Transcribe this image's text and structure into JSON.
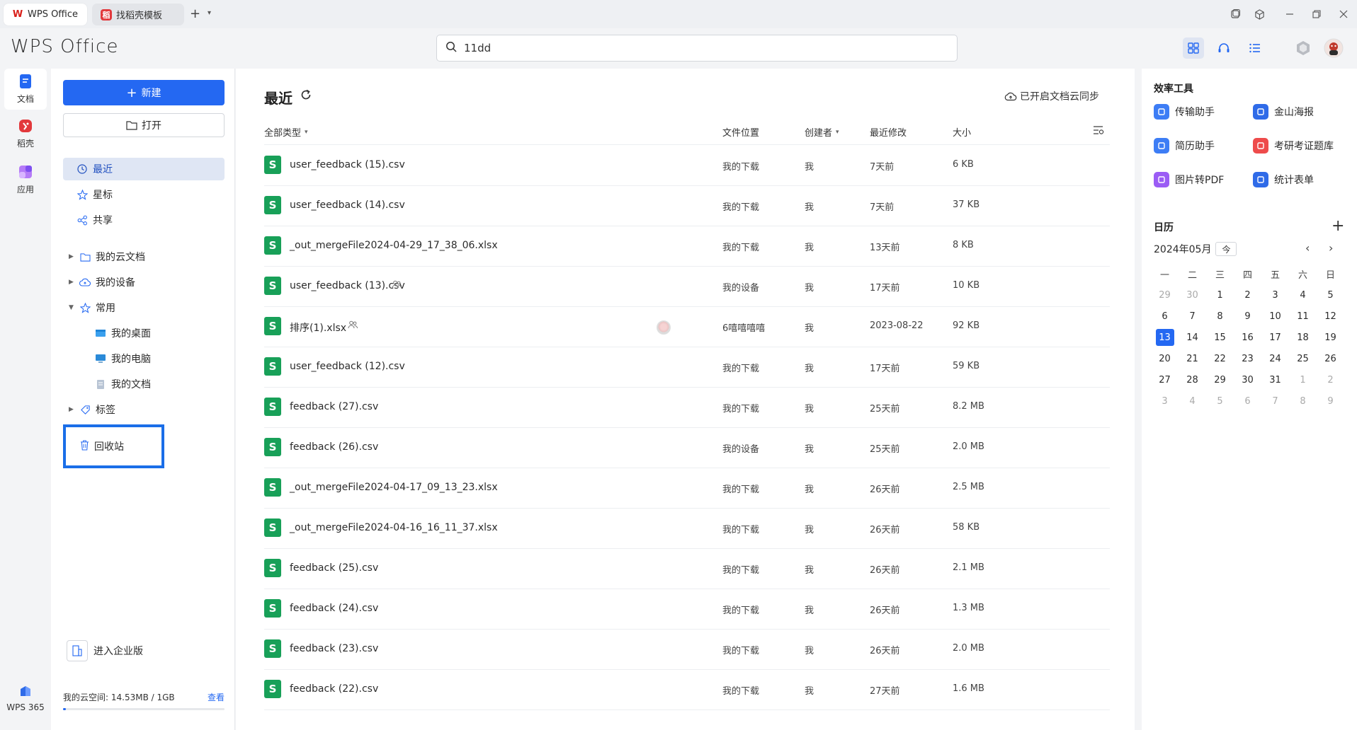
{
  "tabs": [
    {
      "label": "WPS Office"
    },
    {
      "label": "找稻壳模板"
    }
  ],
  "header": {
    "brand": "WPS Office",
    "search_value": "11dd"
  },
  "rail": {
    "items": [
      {
        "label": "文档"
      },
      {
        "label": "稻壳"
      },
      {
        "label": "应用"
      }
    ],
    "bottom_label": "WPS 365"
  },
  "sidebar": {
    "new_label": "新建",
    "open_label": "打开",
    "nav": [
      {
        "label": "最近"
      },
      {
        "label": "星标"
      },
      {
        "label": "共享"
      }
    ],
    "tree": [
      {
        "label": "我的云文档"
      },
      {
        "label": "我的设备"
      },
      {
        "label": "常用"
      },
      {
        "label": "我的桌面"
      },
      {
        "label": "我的电脑"
      },
      {
        "label": "我的文档"
      },
      {
        "label": "标签"
      }
    ],
    "recycle_label": "回收站",
    "enterprise_label": "进入企业版",
    "storage_label": "我的云空间: 14.53MB / 1GB",
    "storage_view": "查看",
    "storage_fraction": 0.014
  },
  "main": {
    "title": "最近",
    "sync_label": "已开启文档云同步",
    "columns": {
      "type": "全部类型",
      "location": "文件位置",
      "owner": "创建者",
      "modified": "最近修改",
      "size": "大小"
    },
    "files": [
      {
        "icon": "S",
        "name": "user_feedback (15).csv",
        "location": "我的下载",
        "owner": "我",
        "modified": "7天前",
        "size": "6 KB"
      },
      {
        "icon": "S",
        "name": "user_feedback (14).csv",
        "location": "我的下载",
        "owner": "我",
        "modified": "7天前",
        "size": "37 KB"
      },
      {
        "icon": "S",
        "name": "_out_mergeFile2024-04-29_17_38_06.xlsx",
        "location": "我的下载",
        "owner": "我",
        "modified": "13天前",
        "size": "8 KB"
      },
      {
        "icon": "S",
        "name": "user_feedback (13).csv",
        "location": "我的设备",
        "owner": "我",
        "modified": "17天前",
        "size": "10 KB"
      },
      {
        "icon": "S",
        "name": "排序(1).xlsx",
        "location": "6嘻嘻嘻嘻",
        "owner": "我",
        "modified": "2023-08-22",
        "size": "92 KB"
      },
      {
        "icon": "S",
        "name": "user_feedback (12).csv",
        "location": "我的下载",
        "owner": "我",
        "modified": "17天前",
        "size": "59 KB"
      },
      {
        "icon": "S",
        "name": "feedback (27).csv",
        "location": "我的下载",
        "owner": "我",
        "modified": "25天前",
        "size": "8.2 MB"
      },
      {
        "icon": "S",
        "name": "feedback (26).csv",
        "location": "我的设备",
        "owner": "我",
        "modified": "25天前",
        "size": "2.0 MB"
      },
      {
        "icon": "S",
        "name": "_out_mergeFile2024-04-17_09_13_23.xlsx",
        "location": "我的下载",
        "owner": "我",
        "modified": "26天前",
        "size": "2.5 MB"
      },
      {
        "icon": "S",
        "name": "_out_mergeFile2024-04-16_16_11_37.xlsx",
        "location": "我的下载",
        "owner": "我",
        "modified": "26天前",
        "size": "58 KB"
      },
      {
        "icon": "S",
        "name": "feedback (25).csv",
        "location": "我的下载",
        "owner": "我",
        "modified": "26天前",
        "size": "2.1 MB"
      },
      {
        "icon": "S",
        "name": "feedback (24).csv",
        "location": "我的下载",
        "owner": "我",
        "modified": "26天前",
        "size": "1.3 MB"
      },
      {
        "icon": "S",
        "name": "feedback (23).csv",
        "location": "我的下载",
        "owner": "我",
        "modified": "26天前",
        "size": "2.0 MB"
      },
      {
        "icon": "S",
        "name": "feedback (22).csv",
        "location": "我的下载",
        "owner": "我",
        "modified": "27天前",
        "size": "1.6 MB"
      }
    ]
  },
  "right": {
    "tools_title": "效率工具",
    "tools": [
      {
        "label": "传输助手",
        "color": "#3d7df5",
        "icon": "transfer-icon"
      },
      {
        "label": "金山海报",
        "color": "#2f6be8",
        "icon": "poster-icon"
      },
      {
        "label": "简历助手",
        "color": "#3d7df5",
        "icon": "resume-icon"
      },
      {
        "label": "考研考证题库",
        "color": "#ee4b4b",
        "icon": "exam-bank-icon"
      },
      {
        "label": "图片转PDF",
        "color": "#9b5cf5",
        "icon": "image-to-pdf-icon"
      },
      {
        "label": "统计表单",
        "color": "#2f6be8",
        "icon": "form-stats-icon"
      }
    ],
    "calendar_title": "日历",
    "month_label": "2024年05月",
    "today_label": "今",
    "weekdays": [
      "一",
      "二",
      "三",
      "四",
      "五",
      "六",
      "日"
    ],
    "days": [
      "29",
      "30",
      "1",
      "2",
      "3",
      "4",
      "5",
      "6",
      "7",
      "8",
      "9",
      "10",
      "11",
      "12",
      "13",
      "14",
      "15",
      "16",
      "17",
      "18",
      "19",
      "20",
      "21",
      "22",
      "23",
      "24",
      "25",
      "26",
      "27",
      "28",
      "29",
      "30",
      "31",
      "1",
      "2",
      "3",
      "4",
      "5",
      "6",
      "7",
      "8",
      "9"
    ],
    "today": "13"
  }
}
